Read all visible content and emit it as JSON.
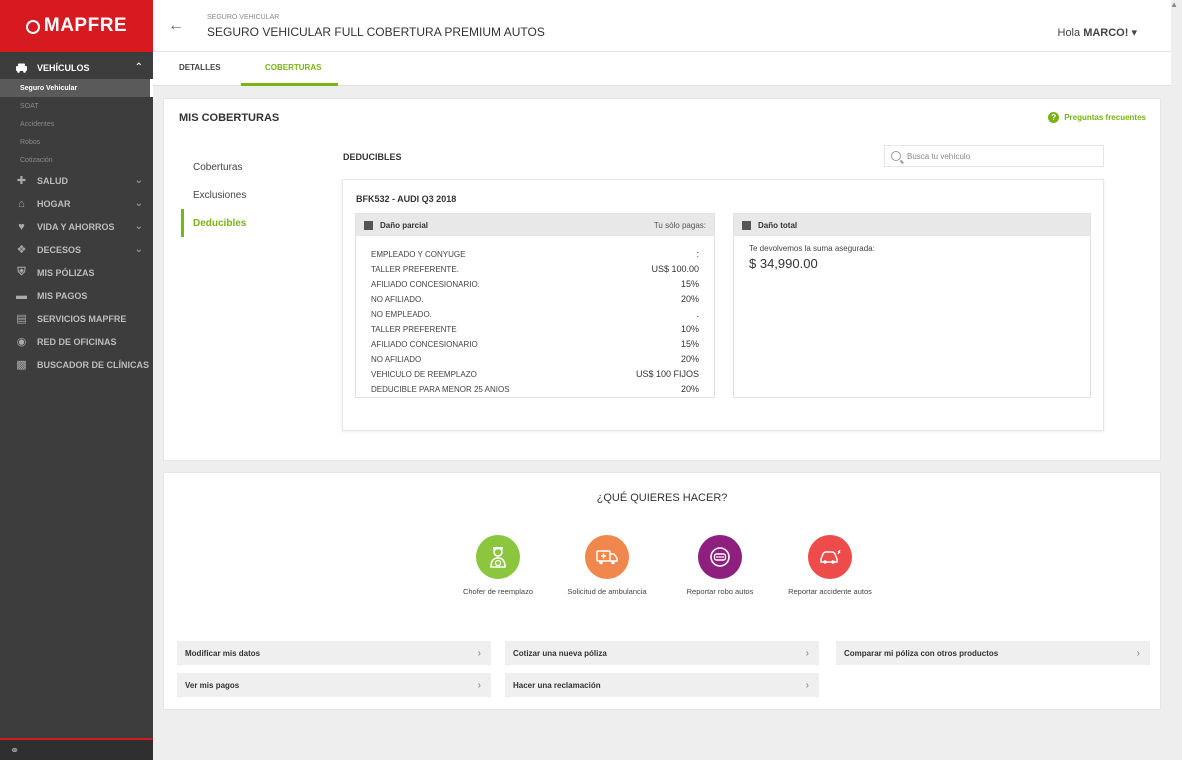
{
  "brand": {
    "name": "MAPFRE",
    "color": "#d71920"
  },
  "sidebar": {
    "items": [
      {
        "label": "VEHÍCULOS",
        "icon": "car-icon",
        "active": true,
        "expanded": true
      },
      {
        "label": "SALUD",
        "icon": "plus-cross-icon",
        "chevron": true
      },
      {
        "label": "HOGAR",
        "icon": "home-icon",
        "chevron": true
      },
      {
        "label": "VIDA Y AHORROS",
        "icon": "heart-icon",
        "chevron": true
      },
      {
        "label": "DECESOS",
        "icon": "dove-icon",
        "chevron": true
      },
      {
        "label": "MIS PÓLIZAS",
        "icon": "shield-icon"
      },
      {
        "label": "MIS PAGOS",
        "icon": "card-icon"
      },
      {
        "label": "SERVICIOS MAPFRE",
        "icon": "services-icon"
      },
      {
        "label": "RED DE OFICINAS",
        "icon": "location-pin-icon"
      },
      {
        "label": "BUSCADOR DE CLÍNICAS",
        "icon": "clinic-icon"
      }
    ],
    "subitems": [
      "Seguro Vehicular",
      "SOAT",
      "Accidentes",
      "Robos",
      "Cotización"
    ]
  },
  "header": {
    "crumb": "SEGURO VEHICULAR",
    "title": "SEGURO VEHICULAR FULL COBERTURA PREMIUM AUTOS",
    "greeting_prefix": "Hola ",
    "user": "MARCO!"
  },
  "tabs": [
    "DETALLES",
    "COBERTURAS"
  ],
  "coverage": {
    "title": "MIS COBERTURAS",
    "faq": "Preguntas frecuentes",
    "side_tabs": [
      "Coberturas",
      "Exclusiones",
      "Deducibles"
    ],
    "section_title": "DEDUCIBLES",
    "search_placeholder": "Busca tu vehículo",
    "vehicle": "BFK532 - AUDI Q3 2018",
    "partial": {
      "title": "Daño parcial",
      "right": "Tu sólo pagas:",
      "rows": [
        {
          "label": "EMPLEADO Y CONYUGE",
          "value": ":"
        },
        {
          "label": "TALLER PREFERENTE.",
          "value": "US$ 100.00"
        },
        {
          "label": "AFILIADO CONCESIONARIO.",
          "value": "15%"
        },
        {
          "label": "NO AFILIADO.",
          "value": "20%"
        },
        {
          "label": "NO EMPLEADO.",
          "value": "."
        },
        {
          "label": "TALLER PREFERENTE",
          "value": "10%"
        },
        {
          "label": "AFILIADO CONCESIONARIO",
          "value": "15%"
        },
        {
          "label": "NO AFILIADO",
          "value": "20%"
        },
        {
          "label": "VEHICULO DE REEMPLAZO",
          "value": "US$ 100 FIJOS"
        },
        {
          "label": "DEDUCIBLE PARA MENOR 25 ANIOS",
          "value": "20%"
        }
      ]
    },
    "total": {
      "title": "Daño total",
      "label": "Te devolvemos la suma asegurada:",
      "amount": "$ 34,990.00"
    }
  },
  "actions": {
    "title": "¿QUÉ QUIERES HACER?",
    "items": [
      {
        "label": "Chofer de reemplazo",
        "color": "#8cc63f",
        "icon": "driver-icon"
      },
      {
        "label": "Solicitud de ambulancia",
        "color": "#f0884e",
        "icon": "ambulance-icon"
      },
      {
        "label": "Reportar robo autos",
        "color": "#8e1f7e",
        "icon": "theft-icon"
      },
      {
        "label": "Reportar accidente autos",
        "color": "#ee4b4b",
        "icon": "crash-icon"
      }
    ]
  },
  "links": [
    "Modificar mis datos",
    "Cotizar una nueva póliza",
    "Comparar mi póliza con otros productos",
    "Ver mis pagos",
    "Hacer una reclamación"
  ],
  "accent": "#7ab317"
}
